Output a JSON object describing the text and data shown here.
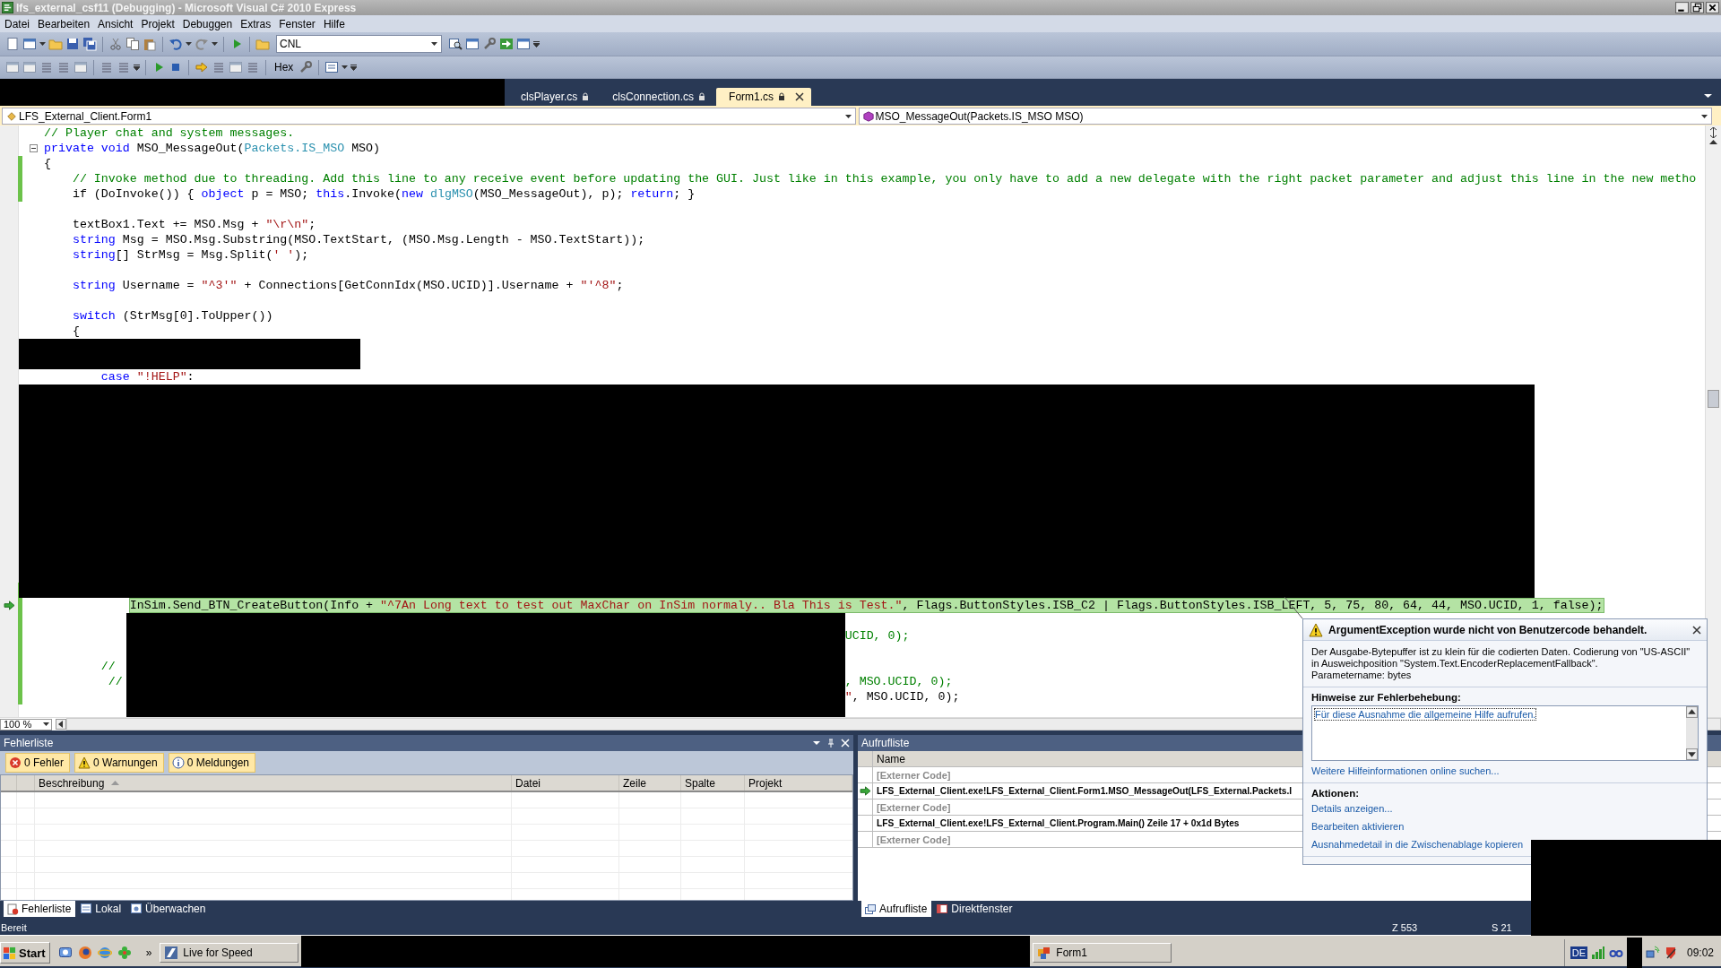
{
  "window": {
    "title": "lfs_external_csf11 (Debugging) - Microsoft Visual C# 2010 Express"
  },
  "menu": [
    "Datei",
    "Bearbeiten",
    "Ansicht",
    "Projekt",
    "Debuggen",
    "Extras",
    "Fenster",
    "Hilfe"
  ],
  "toolbar": {
    "solution_config": "CNL",
    "hex_button": "Hex"
  },
  "document_tabs": [
    {
      "label": "clsPlayer.cs",
      "selected": false
    },
    {
      "label": "clsConnection.cs",
      "selected": false
    },
    {
      "label": "Form1.cs",
      "selected": true
    }
  ],
  "navigation": {
    "type_dropdown": "LFS_External_Client.Form1",
    "member_dropdown": "MSO_MessageOut(Packets.IS_MSO MSO)"
  },
  "editor": {
    "zoom": "100 %",
    "lines": [
      {
        "kind": "code",
        "changed": false,
        "current": false,
        "collapsible": false,
        "segments": [
          {
            "kind": "comment",
            "text": "// Player chat and system messages."
          }
        ]
      },
      {
        "kind": "code",
        "changed": false,
        "current": false,
        "collapsible": true,
        "segments": [
          {
            "kind": "keyword",
            "text": "private void"
          },
          {
            "kind": "plain",
            "text": " MSO_MessageOut("
          },
          {
            "kind": "type",
            "text": "Packets.IS_MSO"
          },
          {
            "kind": "plain",
            "text": " MSO)"
          }
        ]
      },
      {
        "kind": "code",
        "changed": true,
        "current": false,
        "collapsible": false,
        "segments": [
          {
            "kind": "plain",
            "text": "{"
          }
        ]
      },
      {
        "kind": "code",
        "changed": true,
        "current": false,
        "collapsible": false,
        "segments": [
          {
            "kind": "comment",
            "text": "    // Invoke method due to threading. Add this line to any receive event before updating the GUI. Just like in this example, you only have to add a new delegate with the right packet parameter and adjust this line in the new metho"
          }
        ]
      },
      {
        "kind": "code",
        "changed": true,
        "current": false,
        "collapsible": false,
        "segments": [
          {
            "kind": "plain",
            "text": "    if (DoInvoke()) { "
          },
          {
            "kind": "keyword",
            "text": "object"
          },
          {
            "kind": "plain",
            "text": " p = MSO; "
          },
          {
            "kind": "keyword",
            "text": "this"
          },
          {
            "kind": "plain",
            "text": ".Invoke("
          },
          {
            "kind": "keyword",
            "text": "new "
          },
          {
            "kind": "type",
            "text": "dlgMSO"
          },
          {
            "kind": "plain",
            "text": "(MSO_MessageOut), p); "
          },
          {
            "kind": "keyword",
            "text": "return"
          },
          {
            "kind": "plain",
            "text": "; }"
          }
        ]
      },
      {
        "kind": "blank"
      },
      {
        "kind": "code",
        "changed": false,
        "current": false,
        "collapsible": false,
        "segments": [
          {
            "kind": "plain",
            "text": "    textBox1.Text += MSO.Msg + "
          },
          {
            "kind": "string",
            "text": "\"\\r\\n\""
          },
          {
            "kind": "plain",
            "text": ";"
          }
        ]
      },
      {
        "kind": "code",
        "changed": false,
        "current": false,
        "collapsible": false,
        "segments": [
          {
            "kind": "keyword",
            "text": "    string"
          },
          {
            "kind": "plain",
            "text": " Msg = MSO.Msg.Substring(MSO.TextStart, (MSO.Msg.Length - MSO.TextStart));"
          }
        ]
      },
      {
        "kind": "code",
        "changed": false,
        "current": false,
        "collapsible": false,
        "segments": [
          {
            "kind": "keyword",
            "text": "    string"
          },
          {
            "kind": "plain",
            "text": "[] StrMsg = Msg.Split("
          },
          {
            "kind": "string",
            "text": "' '"
          },
          {
            "kind": "plain",
            "text": ");"
          }
        ]
      },
      {
        "kind": "blank"
      },
      {
        "kind": "code",
        "changed": false,
        "current": false,
        "collapsible": false,
        "segments": [
          {
            "kind": "keyword",
            "text": "    string"
          },
          {
            "kind": "plain",
            "text": " Username = "
          },
          {
            "kind": "string",
            "text": "\"^3'\""
          },
          {
            "kind": "plain",
            "text": " + Connections[GetConnIdx(MSO.UCID)].Username + "
          },
          {
            "kind": "string",
            "text": "\"'^8\""
          },
          {
            "kind": "plain",
            "text": ";"
          }
        ]
      },
      {
        "kind": "blank"
      },
      {
        "kind": "code",
        "changed": false,
        "current": false,
        "collapsible": false,
        "segments": [
          {
            "kind": "keyword",
            "text": "    switch"
          },
          {
            "kind": "plain",
            "text": " (StrMsg[0].ToUpper())"
          }
        ]
      },
      {
        "kind": "code",
        "changed": false,
        "current": false,
        "collapsible": false,
        "segments": [
          {
            "kind": "plain",
            "text": "    {"
          }
        ]
      },
      {
        "kind": "blank"
      },
      {
        "kind": "blank"
      },
      {
        "kind": "code",
        "changed": false,
        "current": false,
        "collapsible": false,
        "segments": [
          {
            "kind": "keyword",
            "text": "        case "
          },
          {
            "kind": "string",
            "text": "\"!HELP\""
          },
          {
            "kind": "plain",
            "text": ":"
          }
        ]
      },
      {
        "kind": "blank"
      },
      {
        "kind": "blank"
      },
      {
        "kind": "blank"
      },
      {
        "kind": "blank"
      },
      {
        "kind": "blank"
      },
      {
        "kind": "blank"
      },
      {
        "kind": "blank"
      },
      {
        "kind": "blank"
      },
      {
        "kind": "blank"
      },
      {
        "kind": "blank"
      },
      {
        "kind": "blank"
      },
      {
        "kind": "blank"
      },
      {
        "kind": "blank"
      },
      {
        "kind": "blank",
        "changed": true
      },
      {
        "kind": "code",
        "changed": true,
        "current": true,
        "collapsible": false,
        "segments": [
          {
            "kind": "plain",
            "text": "            InSim.Send_BTN_CreateButton(Info + "
          },
          {
            "kind": "string",
            "text": "\"^7An Long text to test out MaxChar on InSim normaly.. Bla This is Test.\""
          },
          {
            "kind": "plain",
            "text": ", Flags.ButtonStyles.ISB_C2 | Flags.ButtonStyles.ISB_LEFT, 5, 75, 80, 64, 44, MSO.UCID, 1, false);"
          }
        ]
      },
      {
        "kind": "blank",
        "changed": true
      },
      {
        "kind": "split",
        "changed": true,
        "current": false,
        "collapsible": false,
        "tail": [
          {
            "kind": "comment",
            "text": "UCID, 0);"
          }
        ]
      },
      {
        "kind": "blank",
        "changed": true
      },
      {
        "kind": "code",
        "changed": true,
        "current": false,
        "collapsible": false,
        "segments": [
          {
            "kind": "comment",
            "text": "        //"
          }
        ]
      },
      {
        "kind": "split",
        "changed": true,
        "current": false,
        "collapsible": false,
        "head": [
          {
            "kind": "comment",
            "text": "         //"
          }
        ],
        "tail": [
          {
            "kind": "comment",
            "text": ", MSO.UCID, 0);"
          }
        ]
      },
      {
        "kind": "split",
        "changed": true,
        "current": false,
        "collapsible": false,
        "tail": [
          {
            "kind": "string",
            "text": "\""
          },
          {
            "kind": "plain",
            "text": ", MSO.UCID, 0);"
          }
        ]
      }
    ]
  },
  "error_list": {
    "title": "Fehlerliste",
    "filters": [
      {
        "kind": "error",
        "label": "0 Fehler"
      },
      {
        "kind": "warning",
        "label": "0 Warnungen"
      },
      {
        "kind": "info",
        "label": "0 Meldungen"
      }
    ],
    "columns": [
      "Beschreibung",
      "Datei",
      "Zeile",
      "Spalte",
      "Projekt"
    ]
  },
  "call_stack": {
    "title": "Aufrufliste",
    "column": "Name",
    "rows": [
      {
        "kind": "external",
        "current": false,
        "text": "[Externer Code]"
      },
      {
        "kind": "frame",
        "current": true,
        "text": "LFS_External_Client.exe!LFS_External_Client.Form1.MSO_MessageOut(LFS_External.Packets.I"
      },
      {
        "kind": "external",
        "current": false,
        "text": "[Externer Code]"
      },
      {
        "kind": "frame",
        "current": false,
        "text": "LFS_External_Client.exe!LFS_External_Client.Program.Main() Zeile 17 + 0x1d Bytes"
      },
      {
        "kind": "external",
        "current": false,
        "text": "[Externer Code]"
      }
    ]
  },
  "left_tabs": [
    {
      "kind": "errors",
      "label": "Fehlerliste",
      "selected": true
    },
    {
      "kind": "locals",
      "label": "Lokal",
      "selected": false
    },
    {
      "kind": "watch",
      "label": "Überwachen",
      "selected": false
    }
  ],
  "right_tabs": [
    {
      "kind": "callstack",
      "label": "Aufrufliste",
      "selected": true
    },
    {
      "kind": "immediate",
      "label": "Direktfenster",
      "selected": false
    }
  ],
  "exception": {
    "title": "ArgumentException wurde nicht von Benutzercode behandelt.",
    "message": "Der Ausgabe-Bytepuffer ist zu klein für die codierten Daten. Codierung von \"US-ASCII\"\nin Ausweichposition \"System.Text.EncoderReplacementFallback\".\nParametername: bytes",
    "hints_heading": "Hinweise zur Fehlerbehebung:",
    "hints": [
      "Für diese Ausnahme die allgemeine Hilfe aufrufen."
    ],
    "online_link": "Weitere Hilfeinformationen online suchen...",
    "actions_heading": "Aktionen:",
    "actions": [
      "Details anzeigen...",
      "Bearbeiten aktivieren",
      "Ausnahmedetail in die Zwischenablage kopieren"
    ]
  },
  "status_bar": {
    "text": "Bereit",
    "line": "Z 553",
    "column": "S 21"
  },
  "taskbar": {
    "start": "Start",
    "overflow": "»",
    "tasks": [
      {
        "kind": "game",
        "label": "Live for Speed"
      },
      {
        "kind": "form",
        "label": "Form1"
      }
    ],
    "language": "DE",
    "clock": "09:02"
  }
}
